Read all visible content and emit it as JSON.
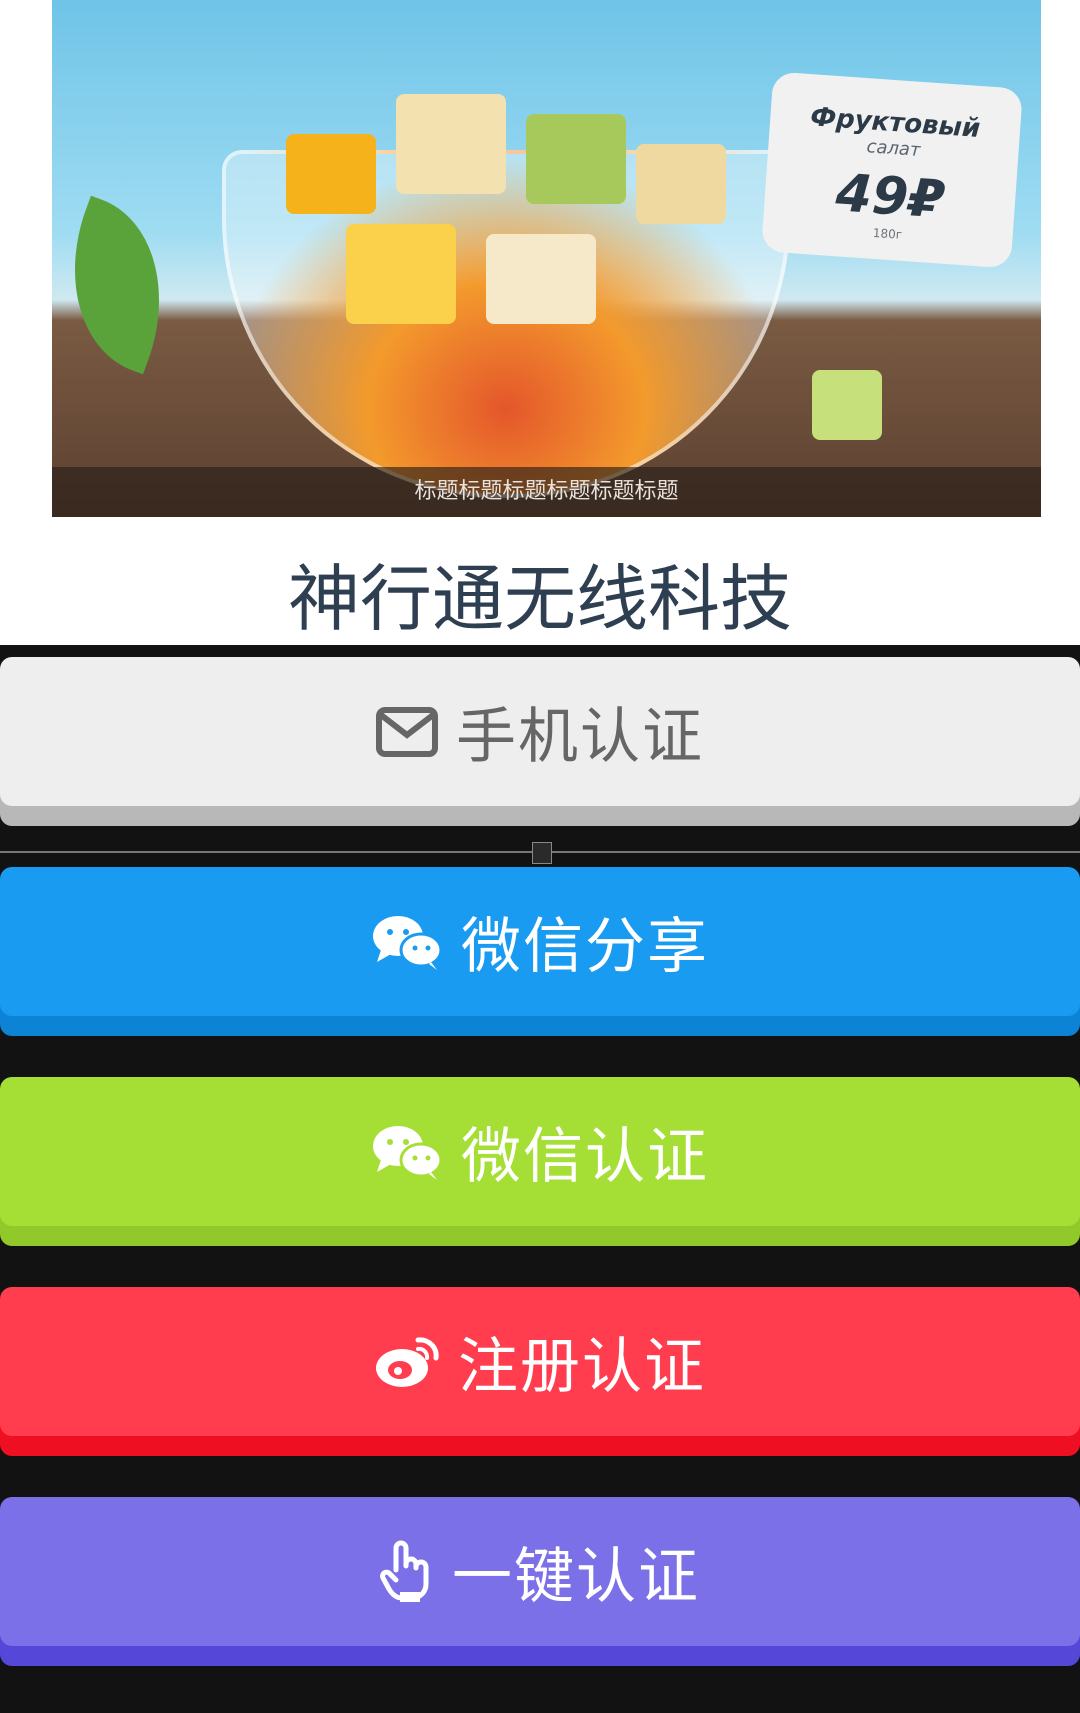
{
  "banner": {
    "caption": "标题标题标题标题标题标题",
    "price_tag": {
      "line1": "Фруктовый",
      "line2": "салат",
      "price": "49₽",
      "weight": "180г"
    }
  },
  "site_title": "神行通无线科技",
  "buttons": {
    "phone_auth": {
      "label": "手机认证",
      "icon": "envelope-icon"
    },
    "wechat_share": {
      "label": "微信分享",
      "icon": "wechat-icon"
    },
    "wechat_auth": {
      "label": "微信认证",
      "icon": "wechat-icon"
    },
    "register_auth": {
      "label": "注册认证",
      "icon": "weibo-icon"
    },
    "one_click_auth": {
      "label": "一键认证",
      "icon": "hand-pointer-icon"
    }
  },
  "colors": {
    "phone_btn": "#eeeeee",
    "wechat_share_btn": "#1a9bf2",
    "wechat_auth_btn": "#a5df35",
    "register_btn": "#ff3d4e",
    "one_click_btn": "#7c70e8",
    "title_text": "#2f3f52"
  }
}
